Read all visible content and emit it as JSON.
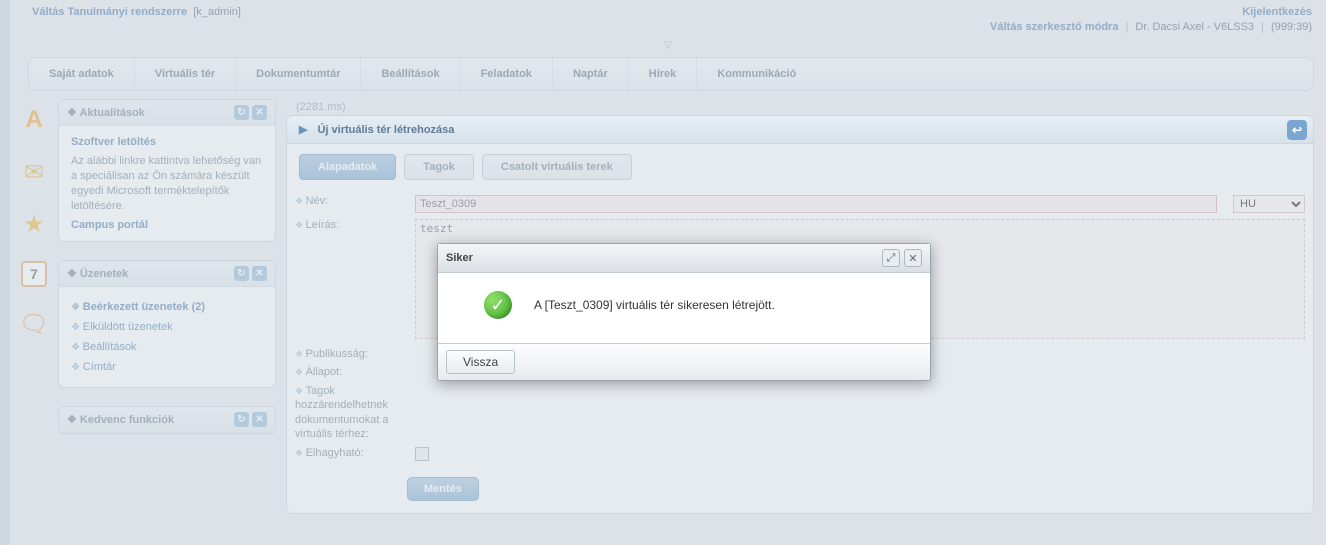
{
  "top": {
    "switch_system": "Váltás Tanulmányi rendszerre",
    "account_tag": "[k_admin]",
    "logout": "Kijelentkezés",
    "switch_editor": "Váltás szerkesztő módra",
    "user": "Dr. Dacsi Axel - V6LSS3",
    "clock": "(999:39)"
  },
  "menu": [
    "Saját adatok",
    "Virtuális tér",
    "Dokumentumtár",
    "Beállítások",
    "Feladatok",
    "Naptár",
    "Hírek",
    "Kommunikáció"
  ],
  "side": {
    "news": {
      "title": "Aktualitások",
      "download_title": "Szoftver letöltés",
      "download_body": "Az alábbi linkre kattintva lehetőség van a speciálisan az Ön számára készült egyedi Microsoft terméktelepítők letöltésére.",
      "campus_link": "Campus portál"
    },
    "messages": {
      "title": "Üzenetek",
      "items": [
        "Beérkezett üzenetek (2)",
        "Elküldött üzenetek",
        "Beállítások",
        "Címtár"
      ]
    },
    "fav": {
      "title": "Kedvenc funkciók"
    }
  },
  "icons": {
    "letter": "A",
    "mail": "✉",
    "star": "★",
    "cal": "7",
    "bubbles": "🗨"
  },
  "main": {
    "timing": "(2281 ms)",
    "title": "Új virtuális tér létrehozása",
    "tabs": [
      "Alapadatok",
      "Tagok",
      "Csatolt virtuális terek"
    ],
    "labels": {
      "name": "Név:",
      "desc": "Leírás:",
      "public": "Publikusság:",
      "state": "Állapot:",
      "members": "Tagok hozzárendelhetnek dokumentumokat a virtuális térhez:",
      "leavable": "Elhagyható:"
    },
    "values": {
      "name": "Teszt_0309",
      "desc": "teszt",
      "lang": "HU"
    },
    "save": "Mentés"
  },
  "dialog": {
    "title": "Siker",
    "message": "A [Teszt_0309] virtuális tér sikeresen létrejött.",
    "back": "Vissza"
  }
}
